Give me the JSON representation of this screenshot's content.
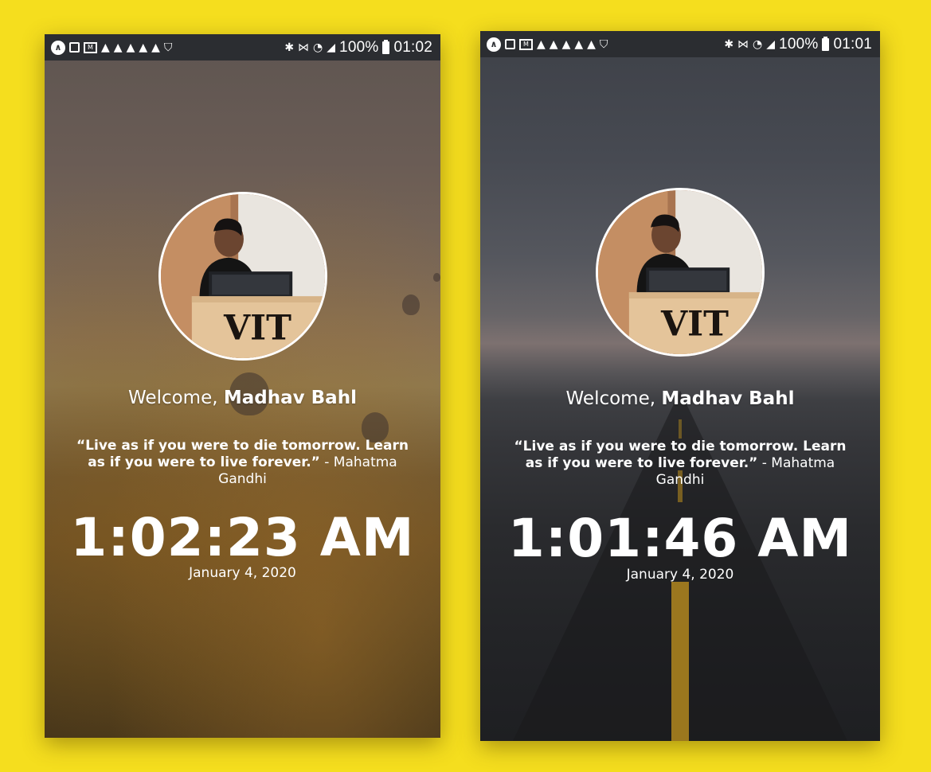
{
  "colors": {
    "page_background": "#f5de1e",
    "status_bar": "#2b2d31",
    "text": "#ffffff"
  },
  "screens": [
    {
      "status_bar": {
        "left_icons": [
          "app-icon",
          "image-icon",
          "gmail-icon",
          "warning-icon",
          "warning-icon",
          "warning-icon",
          "warning-icon",
          "warning-icon",
          "shield-icon"
        ],
        "right_icons": [
          "bluetooth-icon",
          "vibrate-icon",
          "wifi-icon",
          "signal-icon"
        ],
        "battery": "100%",
        "time": "01:02"
      },
      "greeting_prefix": "Welcome,",
      "user_name": "Madhav Bahl",
      "quote_text": "“Live as if you were to die tomorrow. Learn as if you were to live forever.”",
      "quote_author": " - Mahatma Gandhi",
      "clock_time": "1:02:23 AM",
      "date": "January 4, 2020",
      "avatar_sign_text": "VIT",
      "background": "hot-air-balloon-valley"
    },
    {
      "status_bar": {
        "left_icons": [
          "app-icon",
          "image-icon",
          "gmail-icon",
          "warning-icon",
          "warning-icon",
          "warning-icon",
          "warning-icon",
          "warning-icon",
          "shield-icon"
        ],
        "right_icons": [
          "bluetooth-icon",
          "vibrate-icon",
          "wifi-icon",
          "signal-icon"
        ],
        "battery": "100%",
        "time": "01:01"
      },
      "greeting_prefix": "Welcome,",
      "user_name": "Madhav Bahl",
      "quote_text": "“Live as if you were to die tomorrow. Learn as if you were to live forever.”",
      "quote_author": " - Mahatma Gandhi",
      "clock_time": "1:01:46 AM",
      "date": "January 4, 2020",
      "avatar_sign_text": "VIT",
      "background": "night-road"
    }
  ]
}
